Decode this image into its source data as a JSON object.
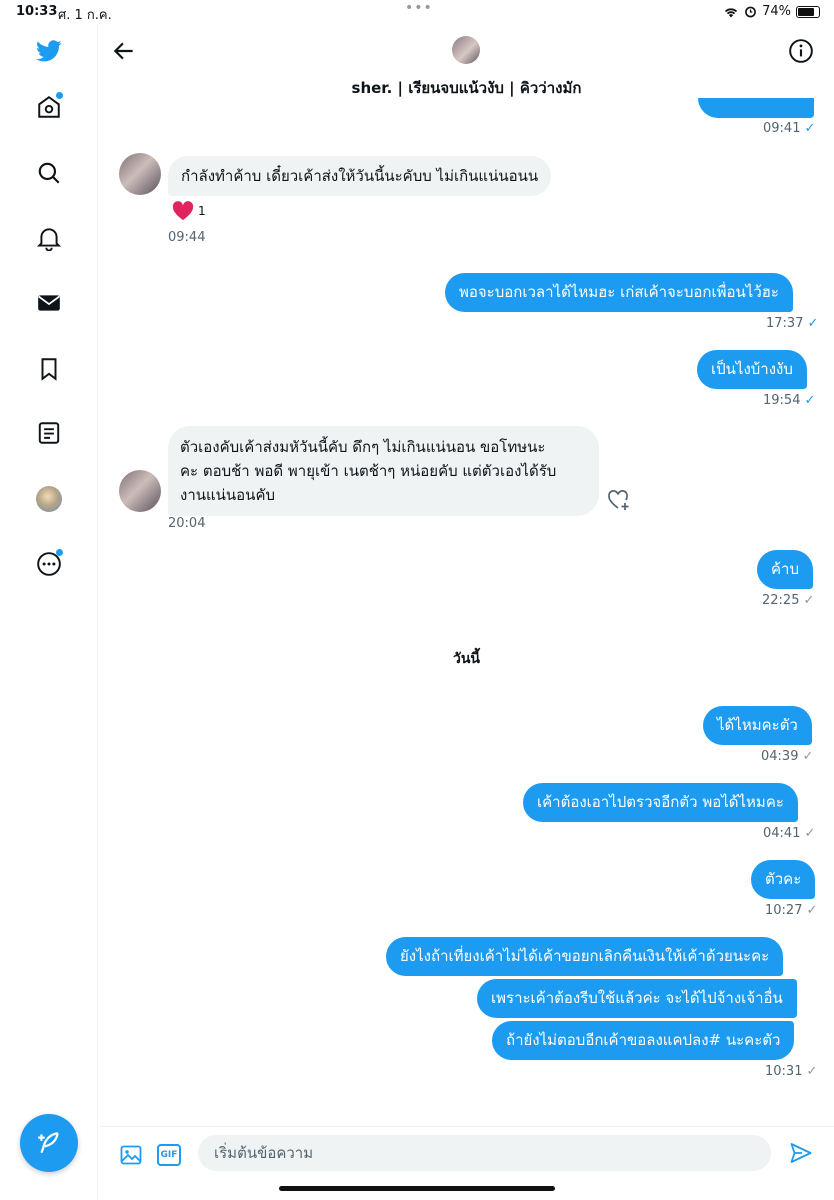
{
  "status_bar": {
    "time": "10:33",
    "date": "ศ. 1 ก.ค.",
    "battery": "74%"
  },
  "header": {
    "title": "sher. | เรียนจบแน้วงับ | คิวว่างมัก"
  },
  "messages": {
    "m0_time": "09:41",
    "m1_text": "กำลังทำค้าบ เดี๋ยวเค้าส่งให้วันนี้นะคับบ ไม่เกินแน่นอนน",
    "m1_reaction_count": "1",
    "m1_time": "09:44",
    "m2_text": "พอจะบอกเวลาได้ไหมฮะ เก่สเค้าจะบอกเพื่อนไว้ฮะ",
    "m2_time": "17:37",
    "m3_text": "เป็นไงบ้างงับ",
    "m3_time": "19:54",
    "m4_line1": "ตัวเองคับเค้าส่งมหัวันนี้คับ ดึกๆ ไม่เกินแน่นอน ขอโทษนะ",
    "m4_line2": "คะ ตอบช้า พอดี พายุเข้า เนตช้าๆ หน่อยคับ แต่ตัวเองได้รับ",
    "m4_line3": "งานแน่นอนคับ",
    "m4_time": "20:04",
    "m5_text": "ค้าบ",
    "m5_time": "22:25",
    "day_label": "วันนี้",
    "m6_text": "ได้ไหมคะตัว",
    "m6_time": "04:39",
    "m7_text": "เค้าต้องเอาไปตรวจอีกตัว พอได้ไหมคะ",
    "m7_time": "04:41",
    "m8_text": "ตัวคะ",
    "m8_time": "10:27",
    "m9_text": "ยังไงถ้าเที่ยงเค้าไม่ได้เค้าขอยกเลิกคืนเงินให้เค้าด้วยนะคะ",
    "m10_text": "เพราะเค้าต้องรีบใช้แล้วค่ะ จะได้ไปจ้างเจ้าอื่น",
    "m11_text": "ถ้ายังไม่ตอบอีกเค้าขอลงแคปลง# นะคะตัว",
    "m11_time": "10:31",
    "check": "✓"
  },
  "composer": {
    "placeholder": "เริ่มต้นข้อความ",
    "gif_label": "GIF"
  },
  "colors": {
    "accent": "#1d9bf0",
    "bubble_in": "#eff3f4",
    "reaction": "#f91880"
  }
}
